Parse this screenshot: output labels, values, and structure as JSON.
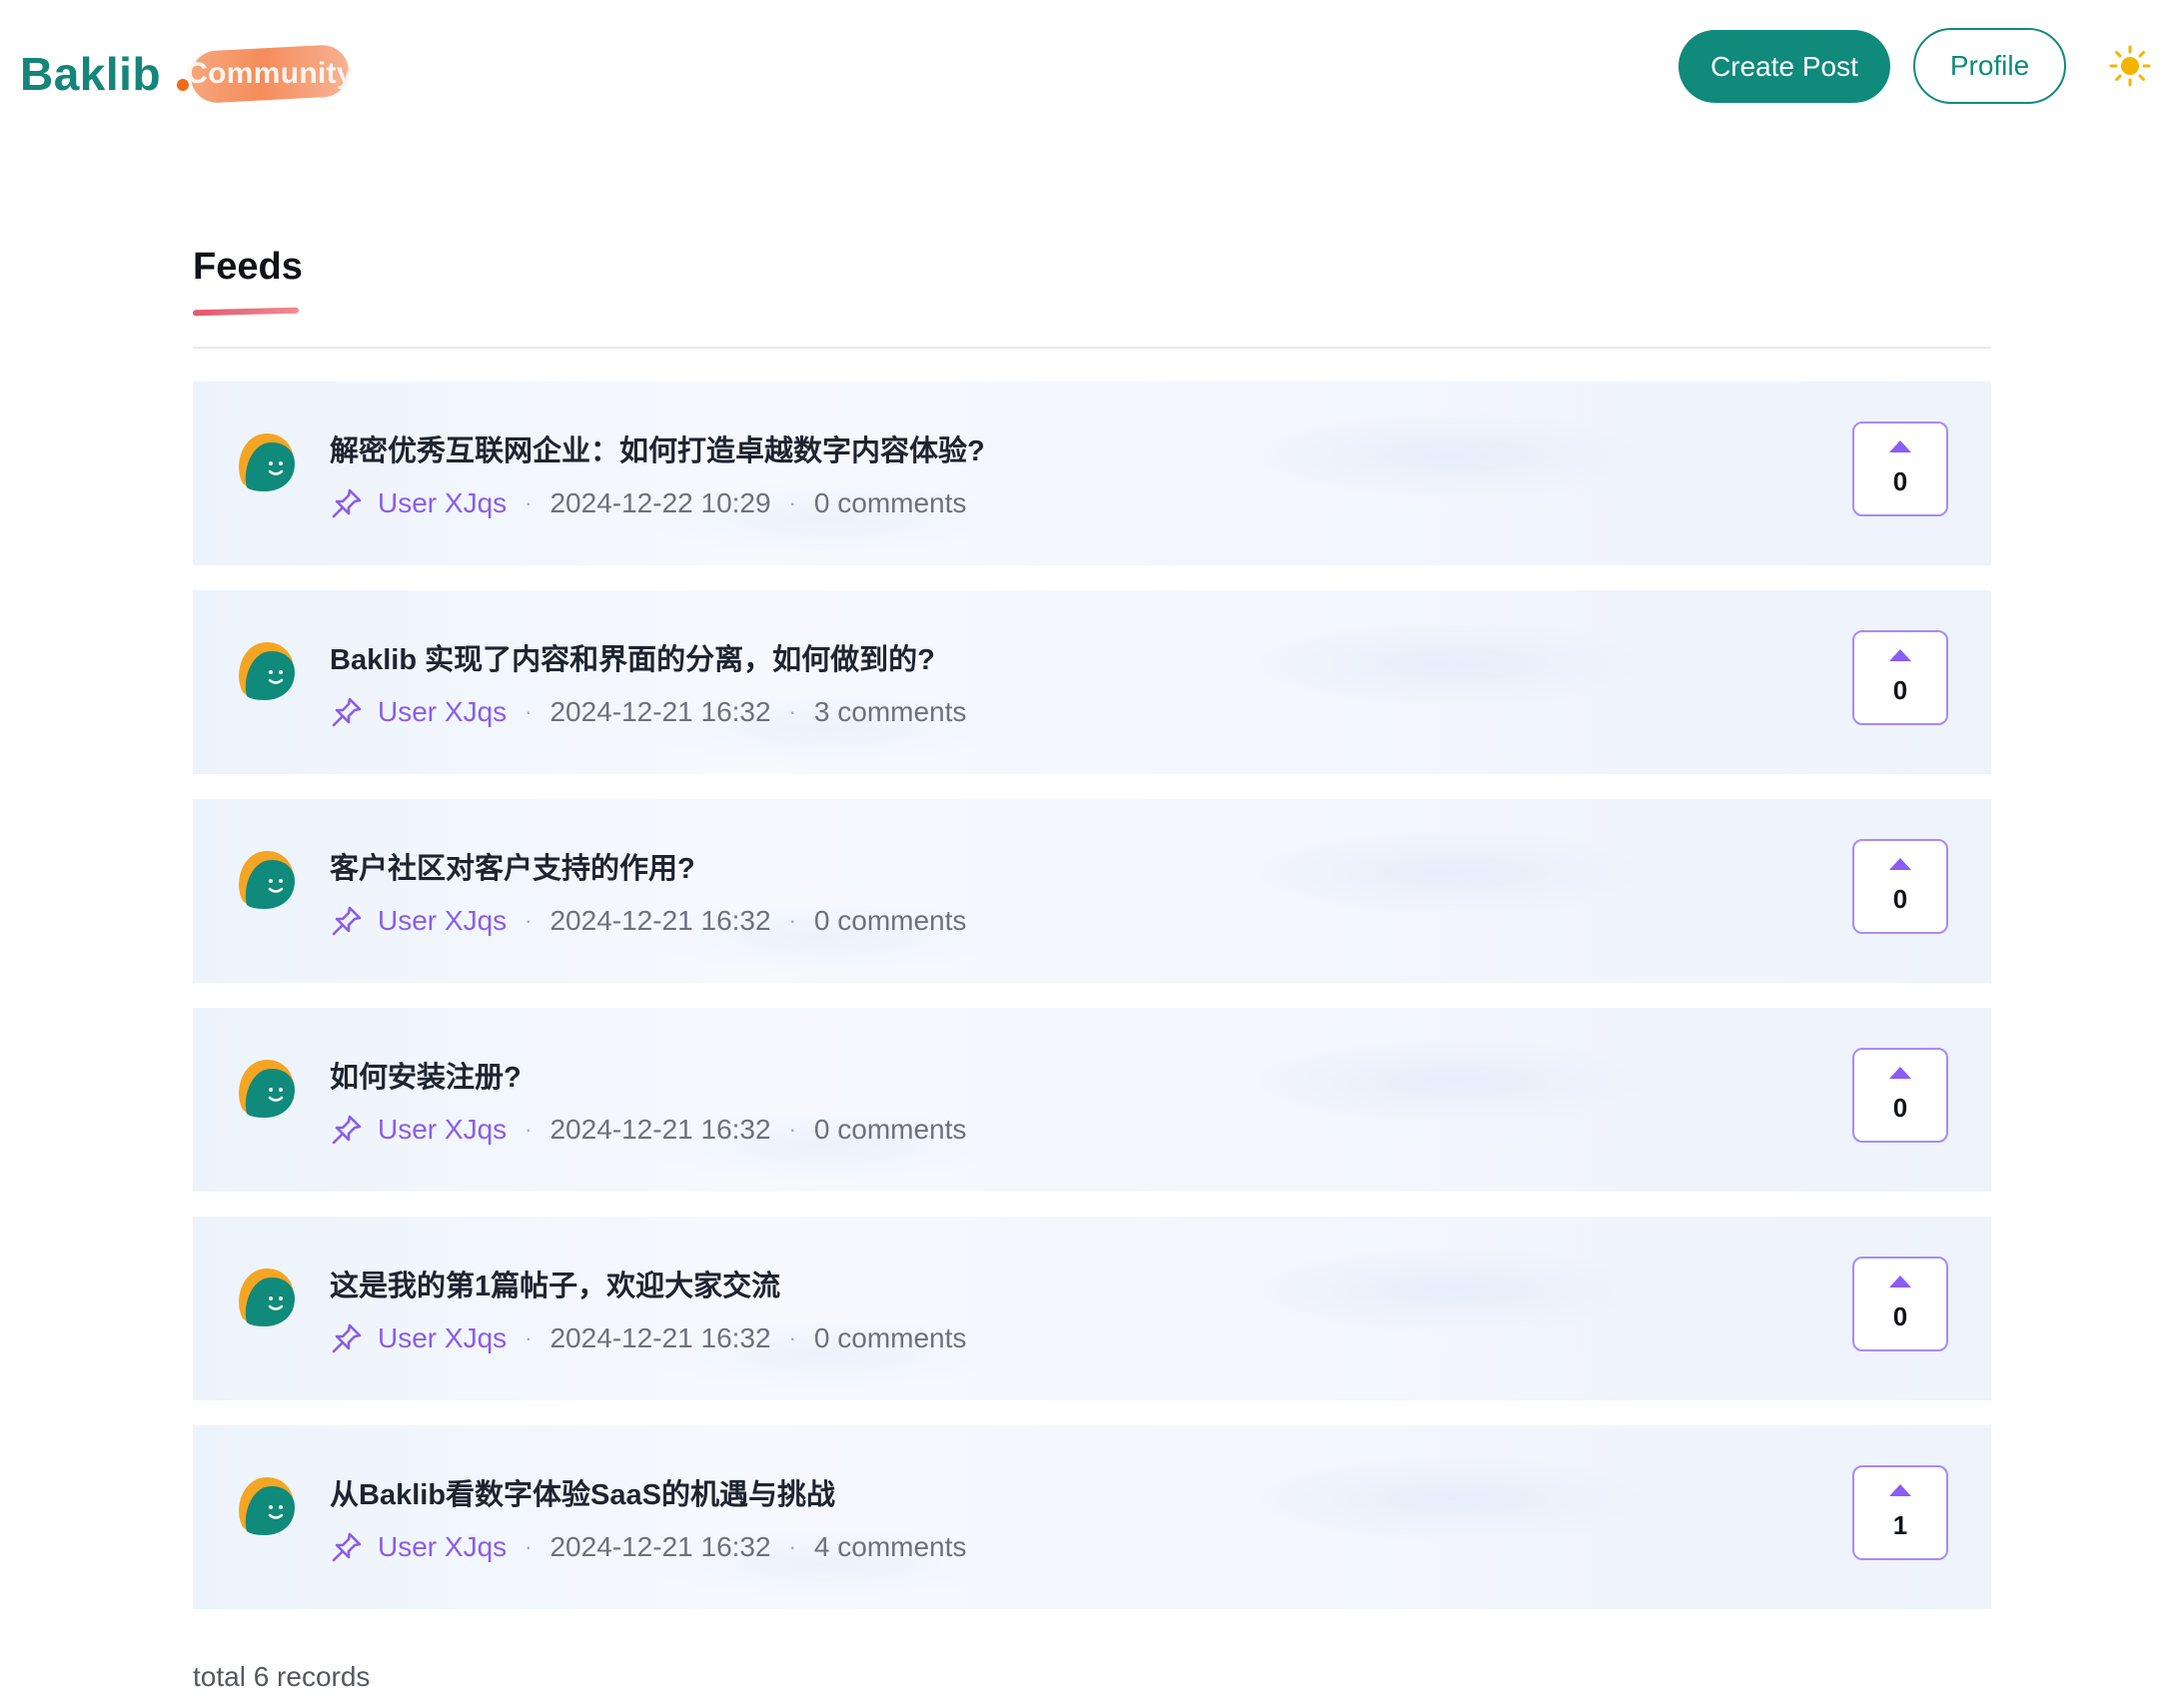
{
  "header": {
    "logo_text": "Baklib",
    "logo_badge": "Community",
    "create_post_label": "Create Post",
    "profile_label": "Profile",
    "theme_icon": "sun-icon"
  },
  "tabs": {
    "feeds_label": "Feeds"
  },
  "feed": {
    "items": [
      {
        "title": "解密优秀互联网企业：如何打造卓越数字内容体验?",
        "author": "User XJqs",
        "date": "2024-12-22 10:29",
        "comments": "0 comments",
        "votes": "0"
      },
      {
        "title": "Baklib 实现了内容和界面的分离，如何做到的?",
        "author": "User XJqs",
        "date": "2024-12-21 16:32",
        "comments": "3 comments",
        "votes": "0"
      },
      {
        "title": "客户社区对客户支持的作用?",
        "author": "User XJqs",
        "date": "2024-12-21 16:32",
        "comments": "0 comments",
        "votes": "0"
      },
      {
        "title": "如何安装注册?",
        "author": "User XJqs",
        "date": "2024-12-21 16:32",
        "comments": "0 comments",
        "votes": "0"
      },
      {
        "title": "这是我的第1篇帖子，欢迎大家交流",
        "author": "User XJqs",
        "date": "2024-12-21 16:32",
        "comments": "0 comments",
        "votes": "0"
      },
      {
        "title": "从Baklib看数字体验SaaS的机遇与挑战",
        "author": "User XJqs",
        "date": "2024-12-21 16:32",
        "comments": "4 comments",
        "votes": "1"
      }
    ],
    "separator": "·"
  },
  "footer": {
    "total_label": "total 6 records"
  },
  "colors": {
    "brand": "#0f8a7b",
    "accent_purple": "#8a5de8",
    "logo_dot": "#f26a1b",
    "sun": "#f5b400"
  }
}
